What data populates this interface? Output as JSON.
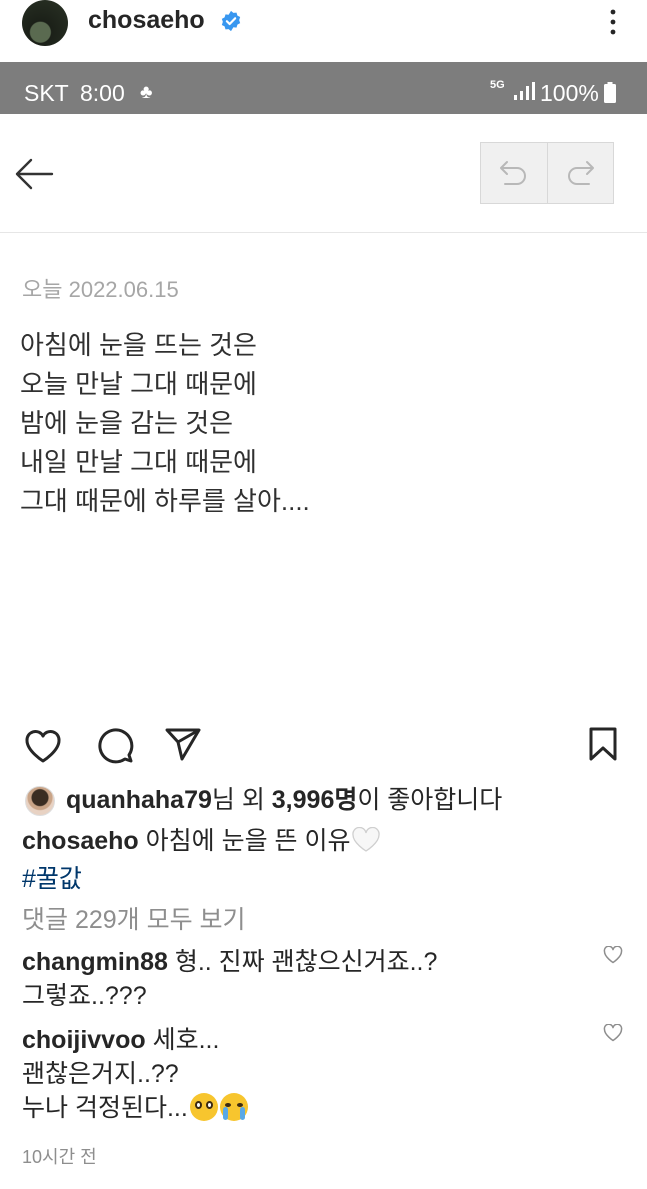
{
  "post_header": {
    "username": "chosaeho",
    "verified_icon": "verified-badge-icon",
    "more_icon": "more-vertical-icon"
  },
  "status_bar": {
    "carrier": "SKT",
    "time": "8:00",
    "network": "5G",
    "battery": "100%"
  },
  "memo_app": {
    "date": "오늘 2022.06.15",
    "lines": [
      "아침에 눈을 뜨는 것은",
      "오늘 만날 그대 때문에",
      "밤에 눈을 감는 것은",
      "내일 만날 그대 때문에",
      "그대 때문에 하루를 살아...."
    ]
  },
  "likes": {
    "user": "quanhaha79",
    "suffix1": "님 외 ",
    "count": "3,996명",
    "suffix2": "이 좋아합니다"
  },
  "caption": {
    "username": "chosaeho",
    "text": " 아침에 눈을 뜬 이유",
    "hashtag": "#꿀값"
  },
  "view_all_comments": "댓글 229개 모두 보기",
  "comments": [
    {
      "username": "changmin88",
      "lines": [
        " 형.. 진짜 괜찮으신거죠..?",
        "그렇죠..???"
      ]
    },
    {
      "username": "choijivvoo",
      "lines": [
        " 세호...",
        "괜찮은거지..??",
        "누나 걱정된다..."
      ]
    }
  ],
  "timestamp": "10시간 전",
  "colors": {
    "status_bar_bg": "#7d7d7d",
    "verified": "#3897f0",
    "hashtag": "#00376b",
    "secondary_text": "#8e8e8e"
  }
}
